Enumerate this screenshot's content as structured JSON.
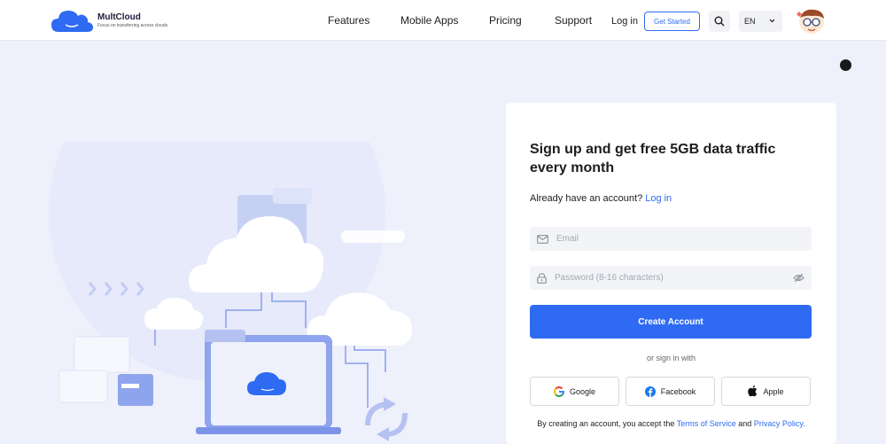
{
  "header": {
    "logo_name": "MultCloud",
    "logo_slogan": "Focus on transferring across clouds",
    "nav": [
      "Features",
      "Mobile Apps",
      "Pricing",
      "Support"
    ],
    "login": "Log in",
    "get_started": "Get Started",
    "language": "EN"
  },
  "signup": {
    "title": "Sign up and get free 5GB data traffic every month",
    "have_account": "Already have an account?",
    "login_link": "Log in",
    "email_placeholder": "Email",
    "password_placeholder": "Password (8-16 characters)",
    "create_button": "Create Account",
    "or_sign_in": "or sign in with",
    "social": [
      "Google",
      "Facebook",
      "Apple"
    ],
    "terms_prefix": "By creating an account, you accept the",
    "terms_link": "Terms of Service",
    "terms_and": "and",
    "privacy_link": "Privacy Policy."
  },
  "colors": {
    "accent": "#2f6bf2",
    "background": "#eef1fb",
    "card": "#ffffff"
  },
  "icons": [
    "cloud-logo-icon",
    "search-icon",
    "chevron-down-icon",
    "avatar-icon",
    "mail-icon",
    "lock-icon",
    "eye-off-icon",
    "google-icon",
    "facebook-icon",
    "apple-icon"
  ]
}
